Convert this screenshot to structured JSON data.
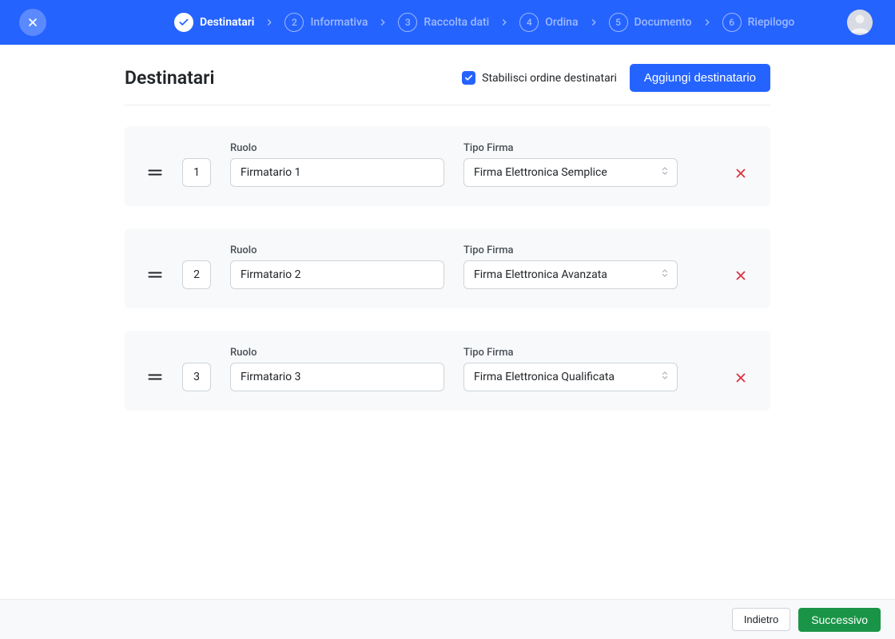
{
  "stepper": {
    "steps": [
      {
        "num": "✓",
        "label": "Destinatari",
        "state": "done"
      },
      {
        "num": "2",
        "label": "Informativa",
        "state": "future"
      },
      {
        "num": "3",
        "label": "Raccolta dati",
        "state": "future"
      },
      {
        "num": "4",
        "label": "Ordina",
        "state": "future"
      },
      {
        "num": "5",
        "label": "Documento",
        "state": "future"
      },
      {
        "num": "6",
        "label": "Riepilogo",
        "state": "future"
      }
    ]
  },
  "page": {
    "title": "Destinatari",
    "order_checkbox_label": "Stabilisci ordine destinatari",
    "add_button": "Aggiungi destinatario",
    "role_label": "Ruolo",
    "signature_label": "Tipo Firma"
  },
  "recipients": [
    {
      "order": "1",
      "role": "Firmatario 1",
      "signature": "Firma Elettronica Semplice"
    },
    {
      "order": "2",
      "role": "Firmatario 2",
      "signature": "Firma Elettronica Avanzata"
    },
    {
      "order": "3",
      "role": "Firmatario 3",
      "signature": "Firma Elettronica Qualificata"
    }
  ],
  "footer": {
    "back": "Indietro",
    "next": "Successivo"
  }
}
